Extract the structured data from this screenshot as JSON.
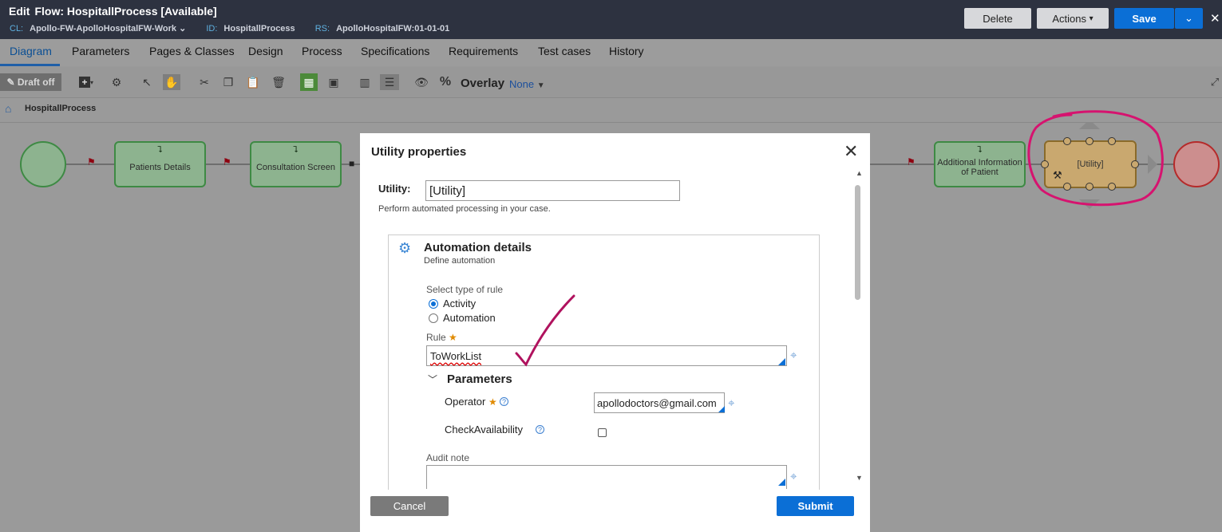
{
  "header": {
    "edit_label": "Edit",
    "title": "Flow: HospitallProcess [Available]",
    "meta": [
      {
        "key": "CL:",
        "value": "Apollo-FW-ApolloHospitalFW-Work"
      },
      {
        "key": "ID:",
        "value": "HospitallProcess"
      },
      {
        "key": "RS:",
        "value": "ApolloHospitalFW:01-01-01"
      }
    ],
    "delete_label": "Delete",
    "actions_label": "Actions",
    "save_label": "Save"
  },
  "tabs": [
    {
      "label": "Diagram",
      "active": true
    },
    {
      "label": "Parameters"
    },
    {
      "label": "Pages & Classes"
    },
    {
      "label": "Design"
    },
    {
      "label": "Process"
    },
    {
      "label": "Specifications"
    },
    {
      "label": "Requirements"
    },
    {
      "label": "Test cases"
    },
    {
      "label": "History"
    }
  ],
  "toolbar": {
    "draft_label": "Draft off",
    "overlay_label": "Overlay",
    "overlay_value": "None"
  },
  "breadcrumb": {
    "label": "HospitallProcess"
  },
  "canvas": {
    "shapes": {
      "patients_details": "Patients Details",
      "consultation_screen": "Consultation Screen",
      "additional_info": "Additional Information of Patient",
      "utility": "[Utility]"
    }
  },
  "modal": {
    "title": "Utility properties",
    "utility_label": "Utility:",
    "utility_value": "[Utility]",
    "utility_desc": "Perform automated processing in your case.",
    "section_title": "Automation details",
    "section_sub": "Define automation",
    "rule_type_label": "Select type of rule",
    "rule_types": [
      {
        "label": "Activity",
        "selected": true
      },
      {
        "label": "Automation",
        "selected": false
      }
    ],
    "rule_label": "Rule",
    "rule_value": "ToWorkList",
    "params_title": "Parameters",
    "operator_label": "Operator",
    "operator_value": "apollodoctors@gmail.com",
    "check_label": "CheckAvailability",
    "check_checked": false,
    "audit_label": "Audit note",
    "cancel_label": "Cancel",
    "submit_label": "Submit"
  },
  "colors": {
    "header_bg": "#2d3240",
    "primary": "#0b6fd6",
    "annotation": "#d6136f",
    "task_fill": "#8db38f",
    "utility_fill": "#c9a86f"
  }
}
